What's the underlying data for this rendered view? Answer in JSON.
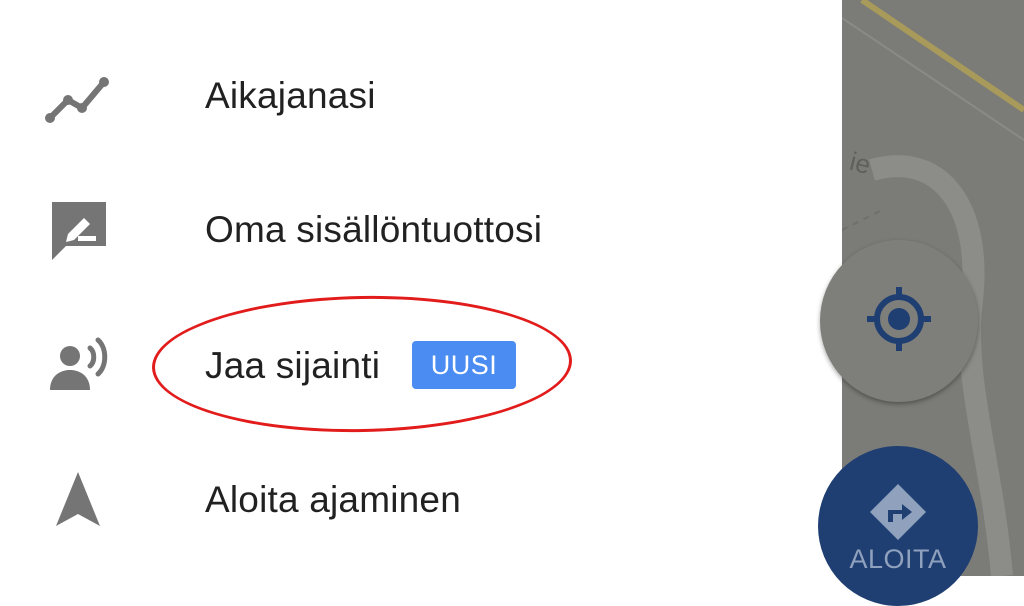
{
  "menu": {
    "items": [
      {
        "label": "Aikajanasi",
        "icon": "timeline-icon"
      },
      {
        "label": "Oma sisällöntuottosi",
        "icon": "contributions-icon"
      },
      {
        "label": "Jaa sijainti",
        "icon": "share-location-icon",
        "badge": "UUSI"
      },
      {
        "label": "Aloita ajaminen",
        "icon": "navigation-arrow-icon"
      }
    ]
  },
  "map": {
    "street_label": "ie",
    "my_location_icon": "my-location-icon",
    "start_button_label": "ALOITA",
    "start_button_icon": "directions-icon"
  },
  "colors": {
    "icon_gray": "#757575",
    "text": "#212121",
    "badge_bg": "#4a8cf2",
    "highlight": "#e21b1b",
    "map_bg": "#7b7b77",
    "map_button_blue": "#1f3f73"
  }
}
